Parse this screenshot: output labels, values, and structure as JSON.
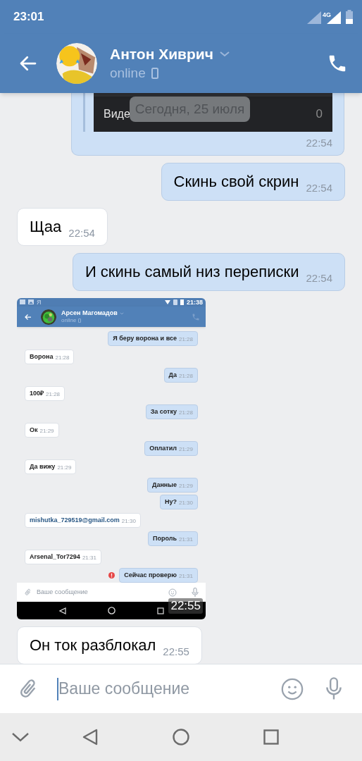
{
  "status_bar": {
    "time": "23:01",
    "network": "4G"
  },
  "header": {
    "name": "Антон Хиврич",
    "status": "online"
  },
  "date_badge": "Сегодня, 25 июля",
  "messages": [
    {
      "kind": "video",
      "title": "Виде",
      "count": "0",
      "time": "22:54"
    },
    {
      "kind": "out",
      "text": "Скинь свой скрин",
      "time": "22:54"
    },
    {
      "kind": "in",
      "text": "Щаа",
      "time": "22:54"
    },
    {
      "kind": "out",
      "text": "И скинь самый низ переписки",
      "time": "22:54"
    },
    {
      "kind": "screenshot",
      "time": "22:55",
      "screen": {
        "status_left": "Я",
        "status_time": "21:38",
        "name": "Арсен Магомадов",
        "status": "online",
        "placeholder": "Ваше сообщение",
        "messages": [
          {
            "kind": "out",
            "text": "Я беру ворона и все",
            "time": "21:28",
            "link": false
          },
          {
            "kind": "in",
            "text": "Ворона",
            "time": "21:28",
            "link": false
          },
          {
            "kind": "out",
            "text": "Да",
            "time": "21:28",
            "link": false
          },
          {
            "kind": "in",
            "text": "100₽",
            "time": "21:28",
            "link": false
          },
          {
            "kind": "out",
            "text": "За сотку",
            "time": "21:28",
            "link": false
          },
          {
            "kind": "in",
            "text": "Ок",
            "time": "21:29",
            "link": false
          },
          {
            "kind": "out",
            "text": "Оплатил",
            "time": "21:29",
            "link": false
          },
          {
            "kind": "in",
            "text": "Да вижу",
            "time": "21:29",
            "link": false
          },
          {
            "kind": "out",
            "text": "Данные",
            "time": "21:29",
            "link": false
          },
          {
            "kind": "out",
            "text": "Ну?",
            "time": "21:30",
            "link": false
          },
          {
            "kind": "in",
            "text": "mishutka_729519@gmail.com",
            "time": "21:30",
            "link": true
          },
          {
            "kind": "out",
            "text": "Пороль",
            "time": "21:31",
            "link": false
          },
          {
            "kind": "in",
            "text": "Arsenal_Tor7294",
            "time": "21:31",
            "link": false
          },
          {
            "kind": "failed",
            "text": "Сейчас проверю",
            "time": "21:31",
            "link": false
          }
        ]
      }
    },
    {
      "kind": "in",
      "text": "Он ток разблокал",
      "time": "22:55"
    }
  ],
  "composer": {
    "placeholder": "Ваше сообщение"
  }
}
